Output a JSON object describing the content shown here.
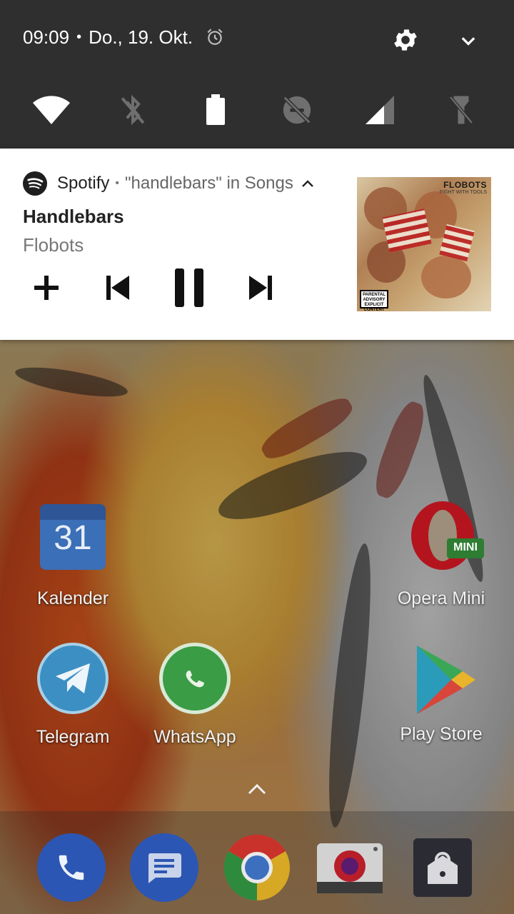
{
  "status": {
    "time": "09:09",
    "separator": "•",
    "date": "Do., 19. Okt."
  },
  "quick_settings": {
    "tiles": [
      "wifi-icon",
      "bluetooth-off-icon",
      "battery-icon",
      "do-not-disturb-off-icon",
      "cellular-signal-icon",
      "flashlight-off-icon"
    ]
  },
  "notification": {
    "app_name": "Spotify",
    "dot": "•",
    "subtext": "\"handlebars\" in Songs",
    "title": "Handlebars",
    "artist": "Flobots",
    "album_art_text": "FLOBOTS",
    "album_art_subtext": "FIGHT WITH TOOLS",
    "advisory": "PARENTAL ADVISORY EXPLICIT CONTENT"
  },
  "home": {
    "apps": [
      {
        "label": "Kalender",
        "icon": "calendar-icon",
        "day": "31"
      },
      {
        "label": "Opera Mini",
        "icon": "opera-mini-icon",
        "badge": "MINI"
      },
      {
        "label": "Telegram",
        "icon": "telegram-icon"
      },
      {
        "label": "WhatsApp",
        "icon": "whatsapp-icon"
      },
      {
        "label": "Play Store",
        "icon": "play-store-icon"
      }
    ],
    "dock": [
      "phone-icon",
      "messages-icon",
      "chrome-icon",
      "camera-icon",
      "lock-icon"
    ]
  },
  "colors": {
    "shade_bg": "#2f2f2f",
    "card_bg": "#ffffff",
    "spotify_icon": "#1e1e1e",
    "dock_blue": "#2c56b3"
  }
}
